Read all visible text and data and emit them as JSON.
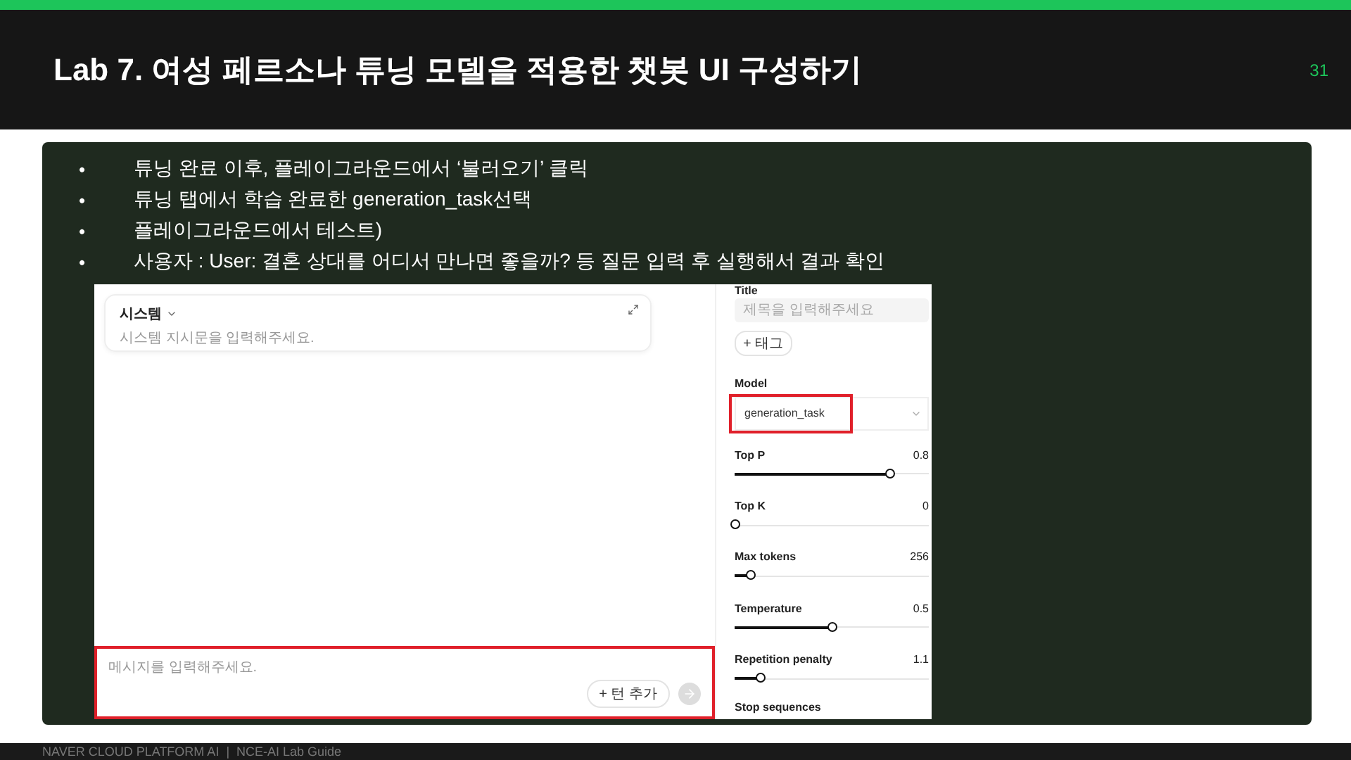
{
  "slide": {
    "title": "Lab 7. 여성 페르소나 튜닝 모델을 적용한 챗봇 UI 구성하기",
    "page_number": "31"
  },
  "bullets": [
    "튜닝 완료 이후, 플레이그라운드에서 ‘불러오기’ 클릭",
    "튜닝 탭에서 학습 완료한 generation_task선택",
    "플레이그라운드에서 테스트)",
    "사용자 : User: 결혼 상대를 어디서 만나면 좋을까? 등 질문 입력 후 실행해서 결과 확인"
  ],
  "bullet_marker": "•",
  "playground": {
    "system_card": {
      "title": "시스템",
      "placeholder": "시스템 지시문을 입력해주세요."
    },
    "message_box": {
      "placeholder": "메시지를 입력해주세요.",
      "highlighted": true,
      "add_turn_button": "+ 턴 추가"
    },
    "settings": {
      "title_label": "Title",
      "title_placeholder": "제목을 입력해주세요",
      "tag_button": "+ 태그",
      "model_label": "Model",
      "model": {
        "value": "generation_task",
        "highlighted": true
      },
      "sliders": [
        {
          "label": "Top P",
          "reading": "0.8",
          "level": 0.8
        },
        {
          "label": "Top K",
          "reading": "0",
          "level": 0
        },
        {
          "label": "Max tokens",
          "reading": "256",
          "level": 0.08
        },
        {
          "label": "Temperature",
          "reading": "0.5",
          "level": 0.5
        },
        {
          "label": "Repetition penalty",
          "reading": "1.1",
          "level": 0.13
        }
      ],
      "stop_label": "Stop sequences"
    }
  },
  "footer": "NAVER CLOUD PLATFORM AI  |  NCE-AI Lab Guide"
}
